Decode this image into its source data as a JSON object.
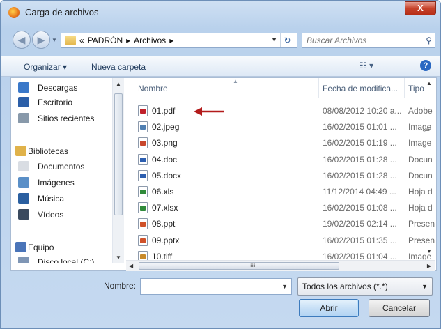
{
  "window": {
    "title": "Carga de archivos",
    "close_label": "X"
  },
  "address": {
    "crumbs": [
      "«",
      "PADRÓN",
      "▸",
      "Archivos",
      "▸"
    ],
    "search_placeholder": "Buscar Archivos"
  },
  "toolbar": {
    "organize_label": "Organizar ▾",
    "new_folder_label": "Nueva carpeta"
  },
  "nav_pane": {
    "items": [
      {
        "label": "Descargas",
        "icon": "downloads-folder-icon",
        "color": "#3a78c9",
        "group": false
      },
      {
        "label": "Escritorio",
        "icon": "desktop-icon",
        "color": "#2c5fa8",
        "group": false
      },
      {
        "label": "Sitios recientes",
        "icon": "recent-places-icon",
        "color": "#8899aa",
        "group": false
      },
      {
        "label": "Bibliotecas",
        "icon": "libraries-icon",
        "color": "#e0b24a",
        "group": true
      },
      {
        "label": "Documentos",
        "icon": "documents-icon",
        "color": "#d9dde3",
        "group": false
      },
      {
        "label": "Imágenes",
        "icon": "pictures-icon",
        "color": "#5a8fc7",
        "group": false
      },
      {
        "label": "Música",
        "icon": "music-icon",
        "color": "#2a5fa0",
        "group": false
      },
      {
        "label": "Vídeos",
        "icon": "videos-icon",
        "color": "#3b4a5e",
        "group": false
      },
      {
        "label": "Equipo",
        "icon": "computer-icon",
        "color": "#4a74b8",
        "group": true
      },
      {
        "label": "Disco local (C:)",
        "icon": "local-disk-icon",
        "color": "#7f96b5",
        "group": false
      }
    ]
  },
  "files": {
    "columns": {
      "name": "Nombre",
      "date": "Fecha de modifica...",
      "type": "Tipo"
    },
    "rows": [
      {
        "name": "01.pdf",
        "date": "08/08/2012 10:20 a...",
        "type": "Adobe",
        "icon": "pdf-file-icon",
        "color": "#c0202a"
      },
      {
        "name": "02.jpeg",
        "date": "16/02/2015 01:01 ...",
        "type": "Image",
        "icon": "jpeg-file-icon",
        "color": "#4f7fb2"
      },
      {
        "name": "03.png",
        "date": "16/02/2015 01:19 ...",
        "type": "Image",
        "icon": "png-file-icon",
        "color": "#c8462c"
      },
      {
        "name": "04.doc",
        "date": "16/02/2015 01:28 ...",
        "type": "Docun",
        "icon": "doc-file-icon",
        "color": "#2b5eb0"
      },
      {
        "name": "05.docx",
        "date": "16/02/2015 01:28 ...",
        "type": "Docun",
        "icon": "docx-file-icon",
        "color": "#2b5eb0"
      },
      {
        "name": "06.xls",
        "date": "11/12/2014 04:49 ...",
        "type": "Hoja d",
        "icon": "xls-file-icon",
        "color": "#2f8a3a"
      },
      {
        "name": "07.xlsx",
        "date": "16/02/2015 01:08 ...",
        "type": "Hoja d",
        "icon": "xlsx-file-icon",
        "color": "#2f8a3a"
      },
      {
        "name": "08.ppt",
        "date": "19/02/2015 02:14 ...",
        "type": "Presen",
        "icon": "ppt-file-icon",
        "color": "#d0522a"
      },
      {
        "name": "09.pptx",
        "date": "16/02/2015 01:35 ...",
        "type": "Presen",
        "icon": "pptx-file-icon",
        "color": "#d0522a"
      },
      {
        "name": "10.tiff",
        "date": "16/02/2015 01:04 ...",
        "type": "Image",
        "icon": "tiff-file-icon",
        "color": "#c88a2a"
      }
    ]
  },
  "annotation": {
    "arrow_color": "#b31b1b"
  },
  "bottom": {
    "name_label": "Nombre:",
    "name_value": "",
    "filter_value": "Todos los archivos (*.*)",
    "open_label": "Abrir",
    "cancel_label": "Cancelar"
  }
}
